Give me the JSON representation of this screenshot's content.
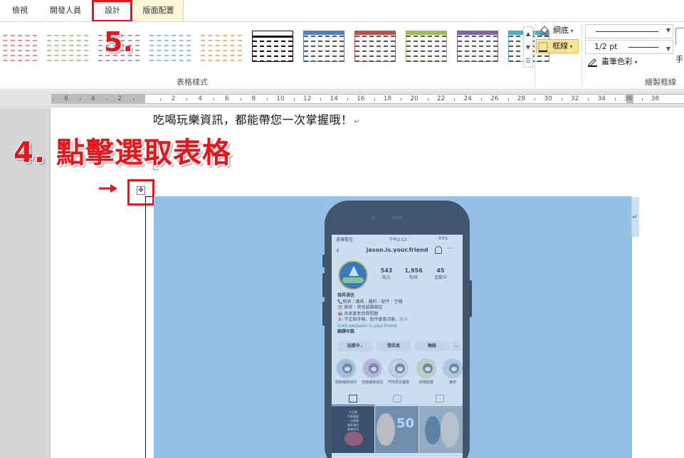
{
  "tabs": [
    "檢視",
    "開發人員",
    "設計",
    "版面配置"
  ],
  "ribbon": {
    "table_styles_group_label": "表格樣式",
    "borders_group_label": "繪製框線",
    "shading_label": "網底",
    "borders_label": "框線",
    "pen_weight_value": "1/2 pt",
    "pen_color_label": "畫筆色彩",
    "draw_table_label": "手",
    "swatch_colors": [
      "#f28c8c",
      "#a8cc8b",
      "#a89bd4",
      "#8ec6d8",
      "#f2b27c",
      "#222222",
      "#4f81bd",
      "#c0504d",
      "#9bbb59",
      "#8064a2",
      "#4bacc6"
    ]
  },
  "ruler": {
    "labels": [
      "6",
      "4",
      "2",
      "2",
      "4",
      "6",
      "8",
      "10",
      "12",
      "14",
      "16",
      "18",
      "20",
      "22",
      "24",
      "26",
      "28",
      "30",
      "32",
      "34",
      "36",
      "38"
    ]
  },
  "document": {
    "body_text": "吃喝玩樂資訊，都能帶您一次掌握哦！",
    "paragraph_mark": "↵",
    "cell_end_mark": "↵",
    "move_handle_glyph": "✥"
  },
  "annotations": {
    "step4_label": "4. 點擊選取表格",
    "step5_label": "5.",
    "arrow": "➔"
  },
  "instagram": {
    "carrier": "遠傳電信",
    "time": "下午2:13",
    "battery": "93%",
    "username": "jason.is.your.friend",
    "stats": [
      {
        "value": "543",
        "label": "貼文"
      },
      {
        "value": "1,956",
        "label": "粉絲"
      },
      {
        "value": "45",
        "label": "追蹤中"
      }
    ],
    "bio": {
      "name": "傑昇通信",
      "lines": [
        "📞新辦｜攜碼｜續約｜配件｜空機",
        "🛠 維修｜使用疑難雜症",
        "📦 各家業者資費問題",
        "🎉 不定期手機、配件優惠活動..."
      ],
      "more": "更多",
      "link": "linktr.ee/jason.is.your.friend",
      "translate": "翻譯年糕"
    },
    "buttons": [
      "追蹤中⌄",
      "發訊息",
      "聯絡",
      "⌄"
    ],
    "highlights": [
      "限時優惠快閃",
      "空機優惠快訊",
      "門市限定優惠",
      "新機開賣",
      "維修"
    ],
    "post_text": "不用懂\n手機優惠\n一次掌握\n傑昇通信\n優惠快訊",
    "post_big": "50"
  }
}
